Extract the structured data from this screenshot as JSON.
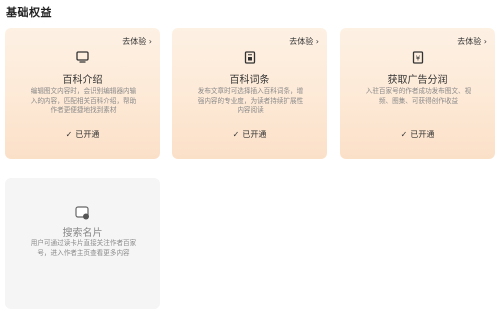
{
  "section_title": "基础权益",
  "cards": [
    {
      "icon": "tv-screen-icon",
      "title": "百科介绍",
      "link": "去体验",
      "desc": "编辑图文内容时，会识别编辑器内输入的内容，匹配相关百科介绍，帮助作者更便捷地找到素材",
      "status": "已开通"
    },
    {
      "icon": "document-tag-icon",
      "title": "百科词条",
      "link": "去体验",
      "desc": "发布文章时可选择插入百科词条，增强内容的专业度，为读者持续扩展性内容阅读",
      "status": "已开通"
    },
    {
      "icon": "revenue-share-icon",
      "title": "获取广告分润",
      "link": "去体验",
      "desc": "入驻百家号的作者成功发布图文、视频、图集、可获得创作收益",
      "status": "已开通"
    },
    {
      "icon": "search-card-icon",
      "title": "搜索名片",
      "desc": "用户可通过读卡片直接关注作者百家号，进入作者主页查看更多内容"
    }
  ],
  "colors": {
    "accent": "#e8883a",
    "warm_bg": "#fde9d6",
    "gray_bg": "#f5f5f6"
  }
}
